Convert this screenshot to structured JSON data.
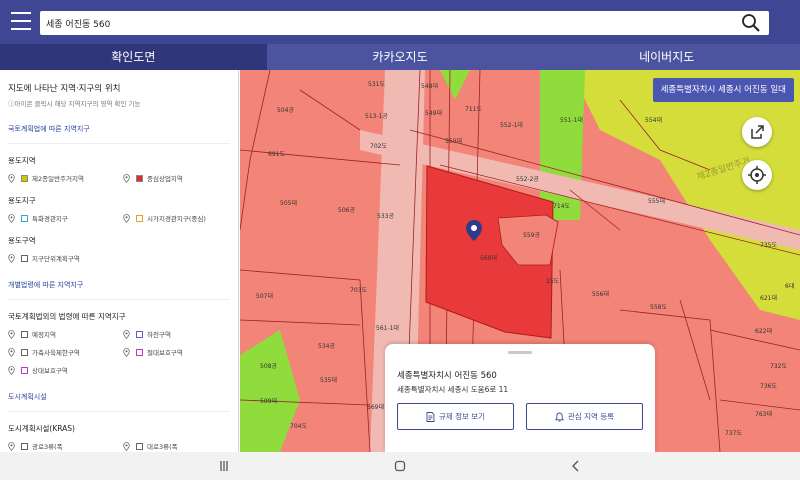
{
  "search": {
    "value": "세종 어진동 560"
  },
  "tabs": [
    {
      "label": "확인도면"
    },
    {
      "label": "카카오지도"
    },
    {
      "label": "네이버지도"
    }
  ],
  "panel": {
    "title": "지도에 나타난 지역·지구의 위치",
    "subtitle": "아이콘 클릭시 해당 지역지구의 영역 확인 기능",
    "section1": "국토계획법에 따른 지역지구",
    "group1": "용도지역",
    "group1_items": [
      {
        "label": "제2종일반주거지역",
        "color": "#c9c900"
      },
      {
        "label": "중심상업지역",
        "color": "#e02b2b"
      }
    ],
    "group2": "용도지구",
    "group2_items": [
      {
        "label": "특화경관지구",
        "color": "#ffffff"
      },
      {
        "label": "시가지경관지구(중심)",
        "color": "#ffffff"
      }
    ],
    "group3": "용도구역",
    "group3_items": [
      {
        "label": "지구단위계획구역",
        "color": "#ffffff"
      }
    ],
    "section2": "개별법령에 따른 지역지구",
    "group4": "국토계획법외의 법령에 따른 지역지구",
    "group4_items": [
      {
        "label": "예정지역",
        "color": "#ffffff"
      },
      {
        "label": "하천구역",
        "color": "#ffffff"
      },
      {
        "label": "가축사육제한구역",
        "color": "#ffffff"
      },
      {
        "label": "절대보호구역",
        "color": "#ffffff"
      },
      {
        "label": "상대보호구역",
        "color": "#ffffff"
      }
    ],
    "section3": "도시계획시설",
    "group5": "도시계획시설(KRAS)",
    "group5_items": [
      {
        "label": "광로3류(폭",
        "color": "#ffffff"
      },
      {
        "label": "대로3류(폭",
        "color": "#ffffff"
      }
    ]
  },
  "map": {
    "area_badge": "세종특별자치시 세종시 어진동 일대",
    "zone_label": "제2종일반주거",
    "parcels": [
      "531도",
      "548대",
      "504공",
      "513-1공",
      "549대",
      "711도",
      "552-1대",
      "551-1대",
      "554대",
      "691도",
      "702도",
      "550대",
      "552-2공",
      "505대",
      "506공",
      "533공",
      "714도",
      "555대",
      "559공",
      "560대",
      "507대",
      "703도",
      "15도",
      "556대",
      "558도",
      "561-1대",
      "622대",
      "534공",
      "508공",
      "732도",
      "535대",
      "509대",
      "569대",
      "704도",
      "562",
      "763대",
      "736도",
      "737도",
      "695도",
      "735도",
      "6대",
      "621대"
    ],
    "colors": {
      "commercial": "#f28478",
      "residential": "#d4dd3a",
      "park": "#8fdc3c",
      "selected": "#e83a3a",
      "road": "#f0b9b2"
    }
  },
  "sheet": {
    "title": "세종특별자치시 어진동 560",
    "address": "세종특별자치시 세종시 도움6로 11",
    "btn_regulation": "규제 정보 보기",
    "btn_interest": "관심 지역 등록"
  }
}
